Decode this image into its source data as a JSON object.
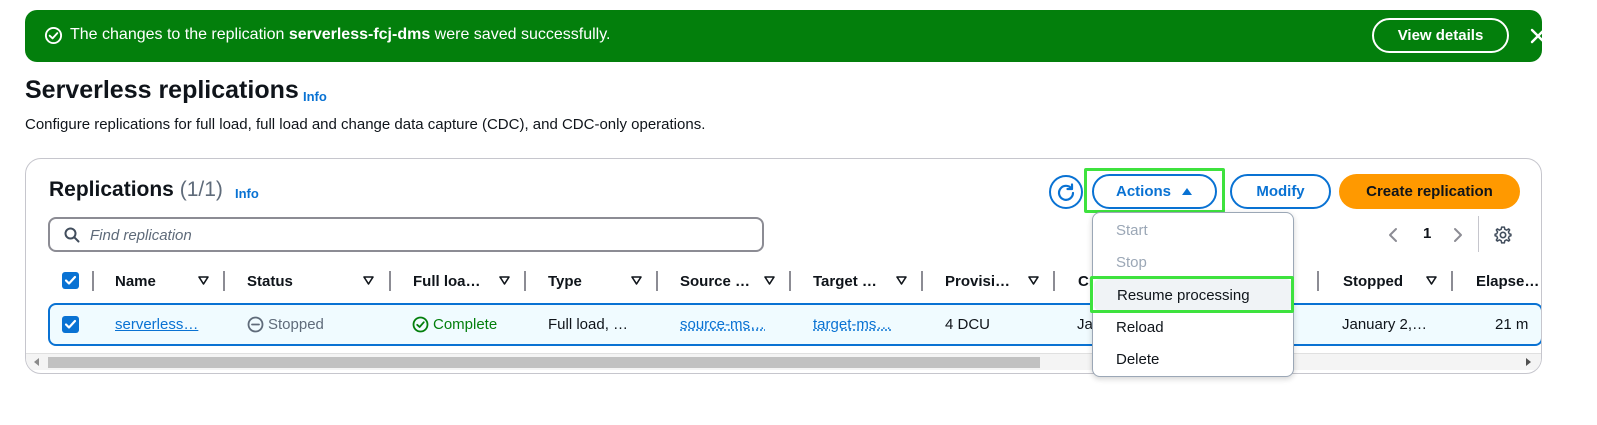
{
  "flash": {
    "text_before": "The changes to the replication ",
    "replication_name": "serverless-fcj-dms",
    "text_after": " were saved successfully.",
    "view_details_label": "View details",
    "background_color": "#037f0c"
  },
  "header": {
    "title": "Serverless replications",
    "info_label": "Info",
    "description": "Configure replications for full load, full load and change data capture (CDC), and CDC-only operations."
  },
  "panel": {
    "title": "Replications",
    "count": "(1/1)",
    "info_label": "Info",
    "refresh_icon": "refresh-icon",
    "actions_label": "Actions",
    "modify_label": "Modify",
    "create_label": "Create replication",
    "search_placeholder": "Find replication",
    "current_page": "1"
  },
  "table": {
    "columns": [
      "Name",
      "Status",
      "Full loa…",
      "Type",
      "Source …",
      "Target …",
      "Provisi…",
      "Cr",
      "Stopped",
      "Elapse…"
    ],
    "row": {
      "name": "serverless…",
      "status": "Stopped",
      "full_load": "Complete",
      "type": "Full load, …",
      "source": "source-ms…",
      "target": "target-ms…",
      "provisioned": "4 DCU",
      "created": "Ja",
      "stopped": "January 2,…",
      "elapsed": "21 m"
    }
  },
  "actions_menu": {
    "items": [
      "Start",
      "Stop",
      "Resume processing",
      "Reload",
      "Delete"
    ]
  },
  "colors": {
    "accent": "#0972d3",
    "primary_button": "#ff9900",
    "success": "#037f0c",
    "annotation_highlight": "#3ee23e"
  }
}
